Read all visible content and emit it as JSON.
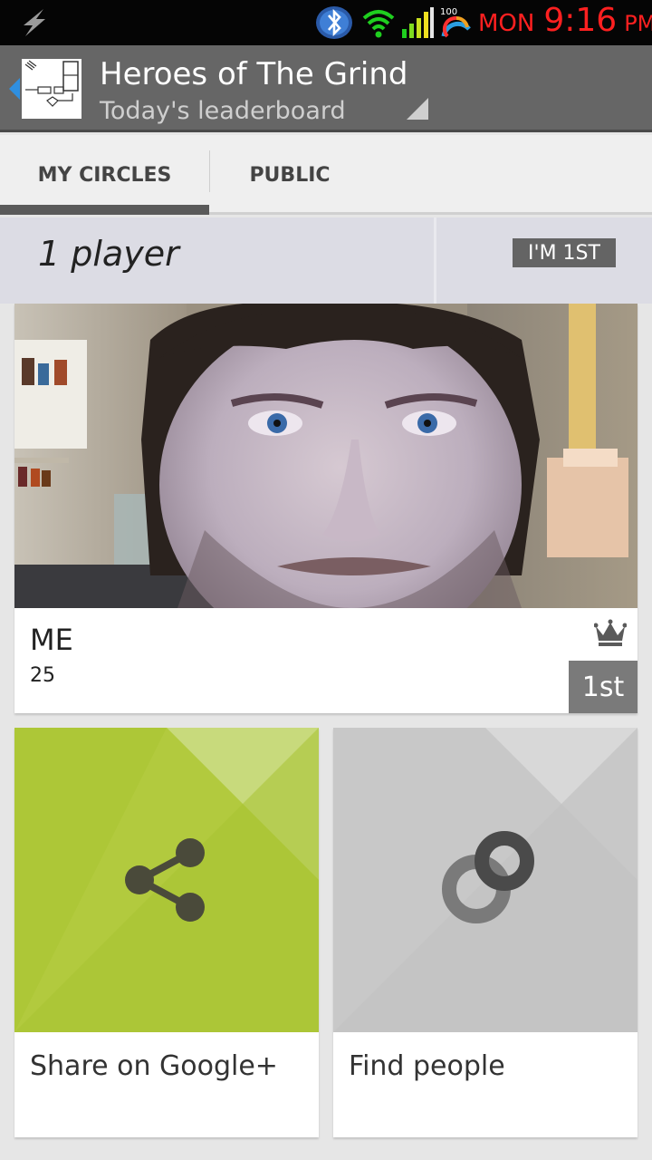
{
  "status_bar": {
    "day": "MON",
    "time": "9:16",
    "ampm": "PM",
    "battery_level_text": "100",
    "clock_color": "#ff2020"
  },
  "action_bar": {
    "title": "Heroes of The Grind",
    "subtitle": "Today's leaderboard",
    "background": "#666666"
  },
  "tabs": [
    {
      "label": "MY CIRCLES",
      "selected": true
    },
    {
      "label": "PUBLIC",
      "selected": false
    }
  ],
  "leaderboard": {
    "player_count": "1 player",
    "my_rank_chip": "I'M 1ST"
  },
  "player": {
    "name": "ME",
    "score": "25",
    "rank": "1st",
    "icon": "crown-icon"
  },
  "tiles": [
    {
      "label": "Share on Google+",
      "icon": "share-icon",
      "color": "#adc737"
    },
    {
      "label": "Find people",
      "icon": "circles-icon",
      "color": "#c8c8c8"
    }
  ]
}
